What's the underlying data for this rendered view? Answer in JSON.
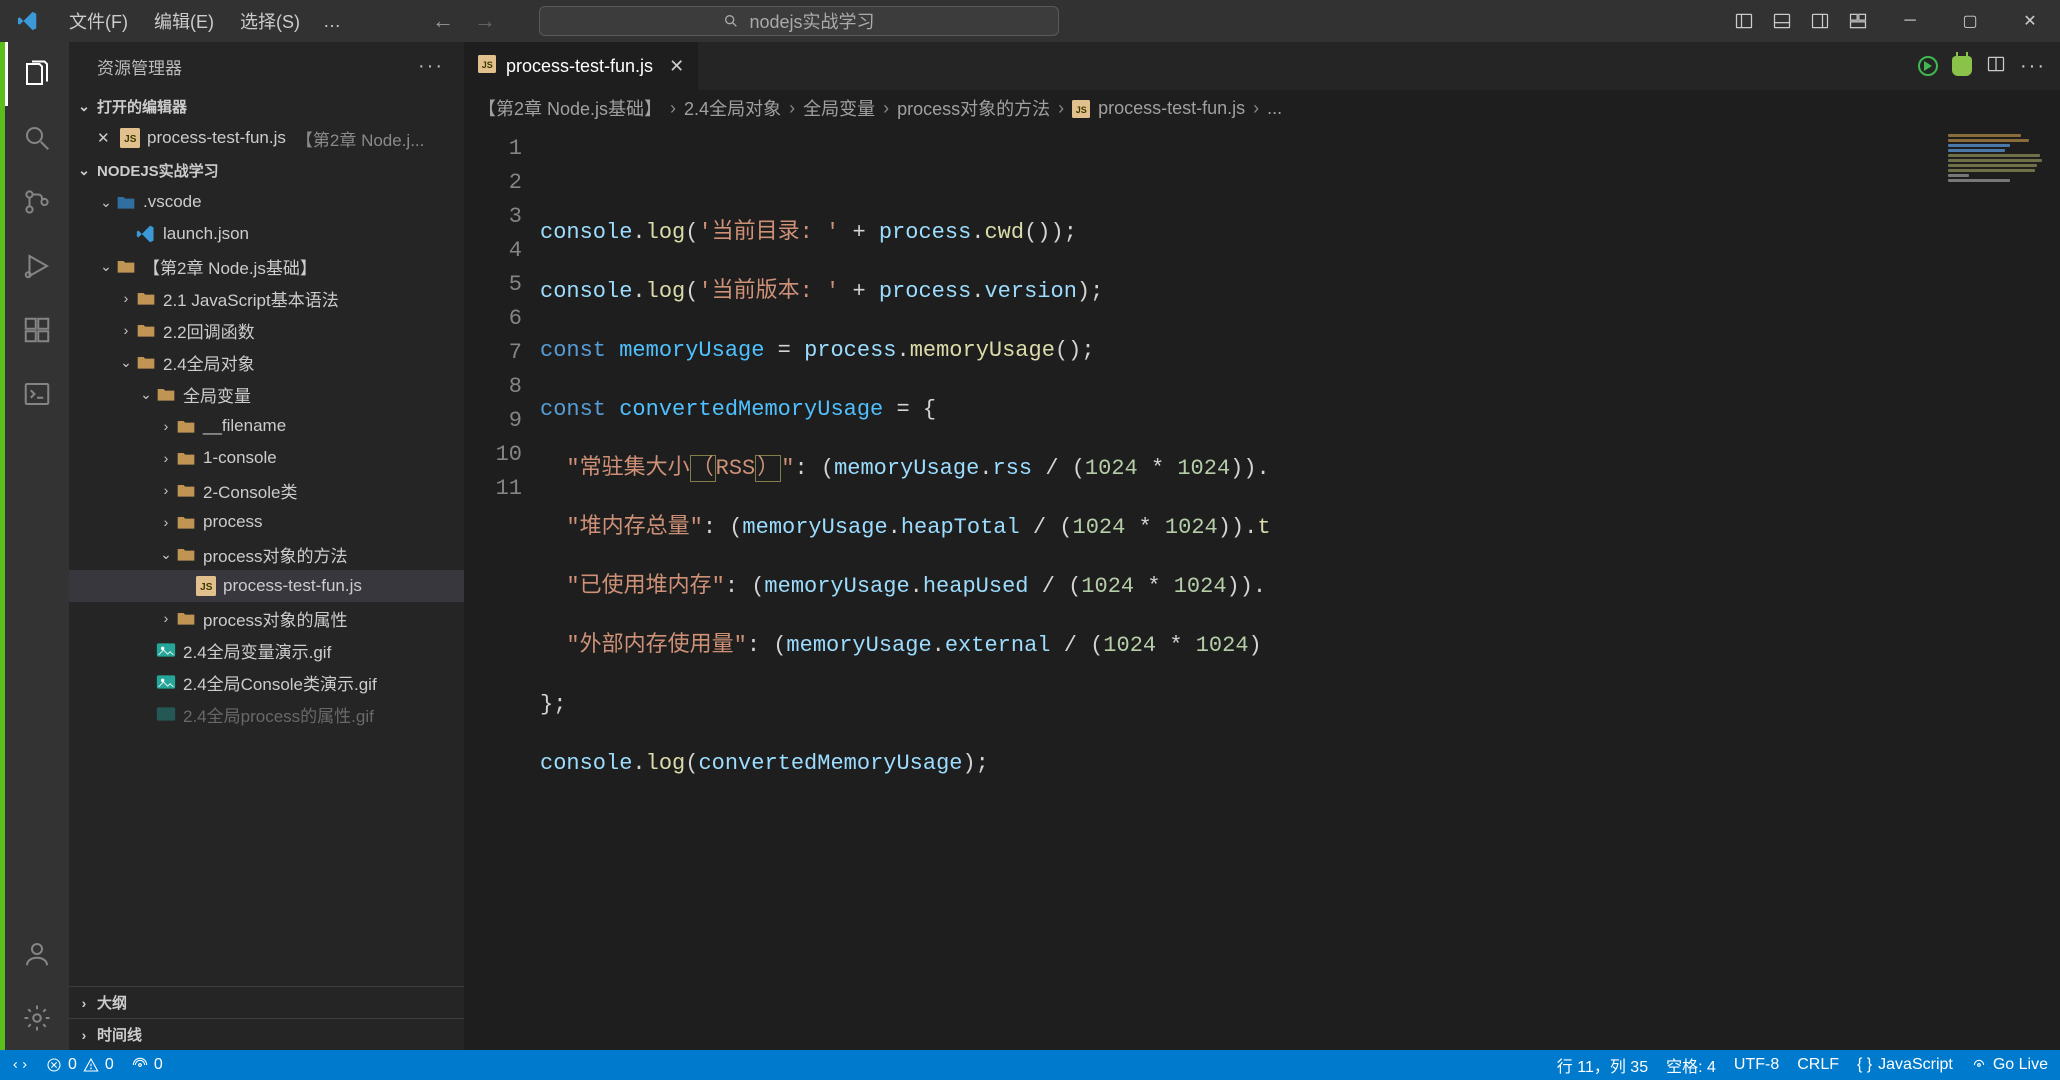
{
  "menu": {
    "file": "文件(F)",
    "edit": "编辑(E)",
    "select": "选择(S)",
    "overflow": "…"
  },
  "commandCenter": {
    "text": "nodejs实战学习"
  },
  "sidebar": {
    "title": "资源管理器",
    "sections": {
      "openEditors": "打开的编辑器",
      "workspace": "NODEJS实战学习",
      "outline": "大纲",
      "timeline": "时间线"
    },
    "openEditor": {
      "file": "process-test-fun.js",
      "folder": "【第2章  Node.j..."
    },
    "tree": {
      "vscode": ".vscode",
      "launch": "launch.json",
      "chap2": "【第2章  Node.js基础】",
      "s21": "2.1  JavaScript基本语法",
      "s22": "2.2回调函数",
      "s24": "2.4全局对象",
      "globals": "全局变量",
      "filename": "__filename",
      "oneConsole": "1-console",
      "twoConsole": "2-Console类",
      "process": "process",
      "processMethods": "process对象的方法",
      "processTestFun": "process-test-fun.js",
      "processProps": "process对象的属性",
      "gif1": "2.4全局变量演示.gif",
      "gif2": "2.4全局Console类演示.gif",
      "gif3": "2.4全局process的属性.gif"
    }
  },
  "tab": {
    "file": "process-test-fun.js"
  },
  "breadcrumb": {
    "p1": "【第2章  Node.js基础】",
    "p2": "2.4全局对象",
    "p3": "全局变量",
    "p4": "process对象的方法",
    "p5": "process-test-fun.js",
    "p6": "..."
  },
  "code": {
    "l1": "",
    "l2_str": "'当前目录: '",
    "l3_str": "'当前版本: '",
    "l6_str": "\"常驻集大小（RSS）\"",
    "l7_str": "\"堆内存总量\"",
    "l8_str": "\"已使用堆内存\"",
    "l9_str": "\"外部内存使用量\"",
    "k_const": "const",
    "v_memoryUsage": "memoryUsage",
    "v_converted": "convertedMemoryUsage",
    "id_console": "console",
    "id_process": "process",
    "fn_log": "log",
    "fn_cwd": "cwd",
    "prop_version": "version",
    "fn_memoryUsage": "memoryUsage",
    "prop_rss": "rss",
    "prop_heapTotal": "heapTotal",
    "prop_heapUsed": "heapUsed",
    "prop_external": "external",
    "num_1024": "1024",
    "prop_t": "t"
  },
  "status": {
    "errors": "0",
    "warnings": "0",
    "port": "0",
    "ln": "行 11，列 35",
    "spaces": "空格: 4",
    "enc": "UTF-8",
    "eol": "CRLF",
    "lang": "JavaScript",
    "trust": "Go Live",
    "remote": ""
  }
}
